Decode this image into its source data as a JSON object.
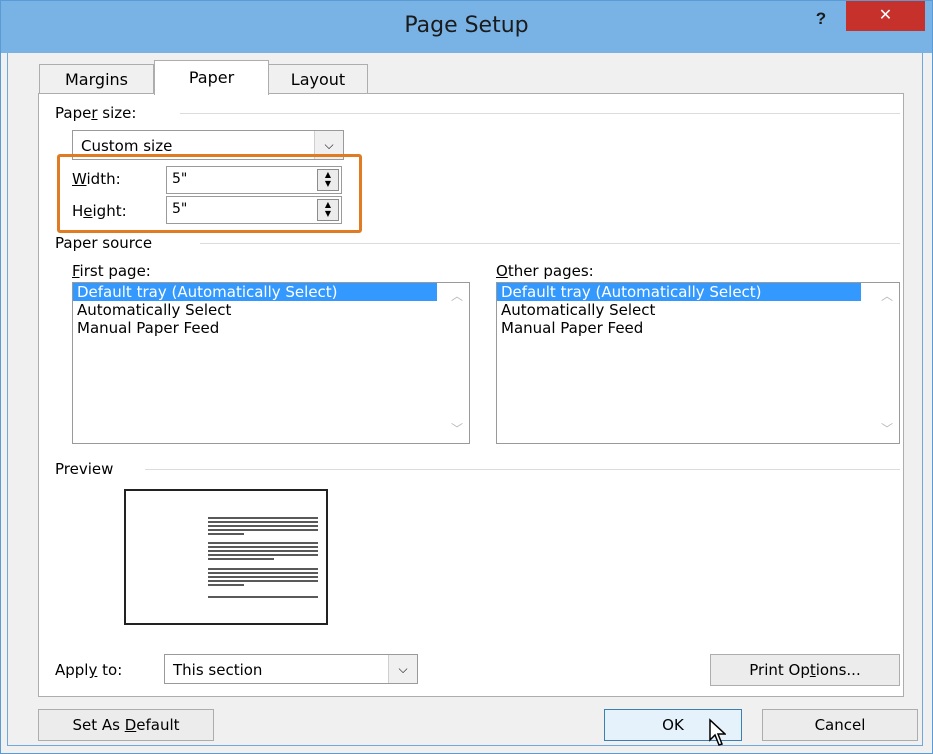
{
  "window": {
    "title": "Page Setup",
    "help_label": "?",
    "close_label": "✕"
  },
  "tabs": [
    {
      "label": "Margins"
    },
    {
      "label": "Paper"
    },
    {
      "label": "Layout"
    }
  ],
  "paper_size": {
    "group_label_pre": "Pape",
    "group_label_key": "r",
    "group_label_post": " size:",
    "selected": "Custom size",
    "width": {
      "label_key": "W",
      "label_rest": "idth:",
      "value": "5\""
    },
    "height": {
      "label_pre": "H",
      "label_key": "e",
      "label_rest": "ight:",
      "value": "5\""
    }
  },
  "paper_source": {
    "group_label": "Paper source",
    "first_page": {
      "label_key": "F",
      "label_rest": "irst page:",
      "items": [
        "Default tray (Automatically Select)",
        "Automatically Select",
        "Manual Paper Feed"
      ],
      "selected_index": 0
    },
    "other_pages": {
      "label_key": "O",
      "label_rest": "ther pages:",
      "items": [
        "Default tray (Automatically Select)",
        "Automatically Select",
        "Manual Paper Feed"
      ],
      "selected_index": 0
    }
  },
  "preview": {
    "group_label": "Preview"
  },
  "apply_to": {
    "label_pre": "Appl",
    "label_key": "y",
    "label_rest": " to:",
    "selected": "This section"
  },
  "buttons": {
    "print_options_pre": "Print Op",
    "print_options_key": "t",
    "print_options_rest": "ions...",
    "set_default_pre": "Set As ",
    "set_default_key": "D",
    "set_default_rest": "efault",
    "ok": "OK",
    "cancel": "Cancel"
  },
  "colors": {
    "title_bar": "#79b3e6",
    "close": "#c7312b",
    "selection": "#3399ff",
    "highlight": "#e07b24"
  },
  "icons": {
    "combo_arrow": "chevron-down-icon",
    "cursor": "mouse-pointer-icon"
  }
}
